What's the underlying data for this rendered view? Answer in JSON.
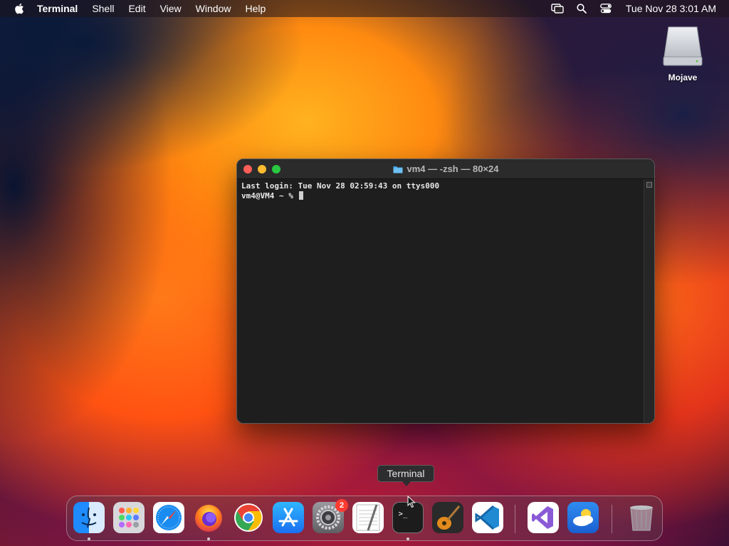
{
  "menubar": {
    "app_name": "Terminal",
    "items": [
      "Shell",
      "Edit",
      "View",
      "Window",
      "Help"
    ],
    "clock": "Tue Nov 28  3:01 AM",
    "icons": [
      "screen-mirroring-icon",
      "search-icon",
      "control-center-icon"
    ]
  },
  "desktop": {
    "drive_label": "Mojave"
  },
  "terminal": {
    "title": "vm4 — -zsh — 80×24",
    "lines": [
      "Last login: Tue Nov 28 02:59:43 on ttys000",
      "vm4@VM4 ~ % "
    ]
  },
  "tooltip": {
    "label": "Terminal"
  },
  "dock": {
    "apps": [
      {
        "name": "finder",
        "running": true
      },
      {
        "name": "launchpad",
        "running": false
      },
      {
        "name": "safari",
        "running": false
      },
      {
        "name": "firefox",
        "running": true
      },
      {
        "name": "chrome",
        "running": false
      },
      {
        "name": "app-store",
        "running": false
      },
      {
        "name": "system-settings",
        "running": false,
        "badge": "2"
      },
      {
        "name": "textedit",
        "running": false
      },
      {
        "name": "terminal",
        "running": true
      },
      {
        "name": "garageband",
        "running": false
      },
      {
        "name": "vscode",
        "running": false
      },
      {
        "name": "visual-studio",
        "running": false
      },
      {
        "name": "weather",
        "running": false
      },
      {
        "name": "trash",
        "running": false
      }
    ],
    "colors": {
      "finder": "#1e8bff",
      "safari": "#1a8cf0",
      "app_store": "#1a8cf0",
      "vscode": "#1f8ad2",
      "visual_studio": "#8a5ad6",
      "terminal": "#1c1c1c"
    }
  }
}
